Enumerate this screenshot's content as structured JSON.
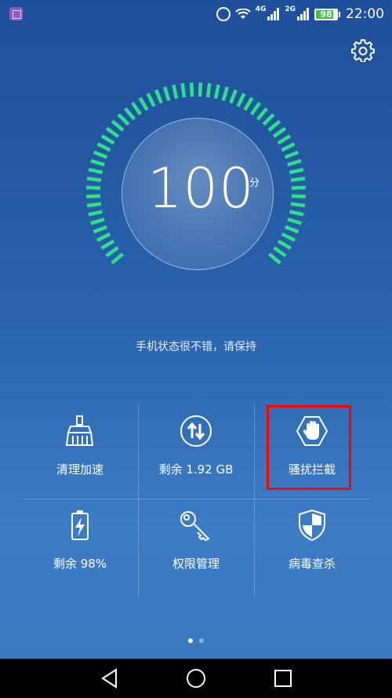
{
  "status_bar": {
    "network_1": "4G",
    "network_2": "2G",
    "battery": "98",
    "time": "22:00"
  },
  "gauge": {
    "score": "100",
    "unit": "分"
  },
  "tagline": "手机状态很不错，请保持",
  "tiles": [
    {
      "label": "清理加速",
      "icon": "broom-icon"
    },
    {
      "label": "剩余 1.92 GB",
      "icon": "data-transfer-icon"
    },
    {
      "label": "骚扰拦截",
      "icon": "hand-block-icon"
    },
    {
      "label": "剩余 98%",
      "icon": "battery-icon"
    },
    {
      "label": "权限管理",
      "icon": "key-icon"
    },
    {
      "label": "病毒查杀",
      "icon": "shield-icon"
    }
  ],
  "pager": {
    "pages": 2,
    "current": 1
  },
  "colors": {
    "gauge_accent": "#2de08a",
    "highlight": "#ff0000",
    "battery_fill": "#3cc43c"
  }
}
